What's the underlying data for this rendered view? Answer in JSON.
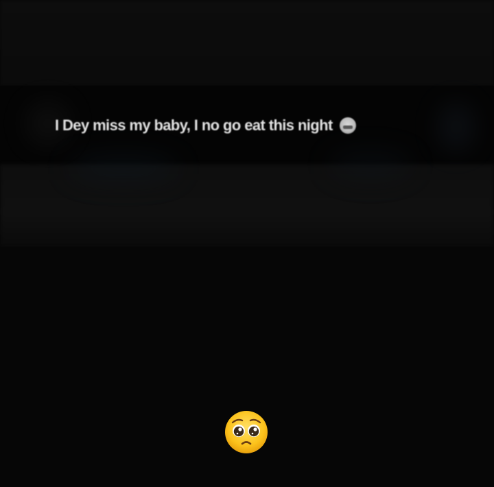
{
  "caption": {
    "text": "I Dey miss my baby, I no go eat this night",
    "emoji": "grimacing-face-emoji"
  },
  "overlay_emoji": "pleading-face-emoji"
}
